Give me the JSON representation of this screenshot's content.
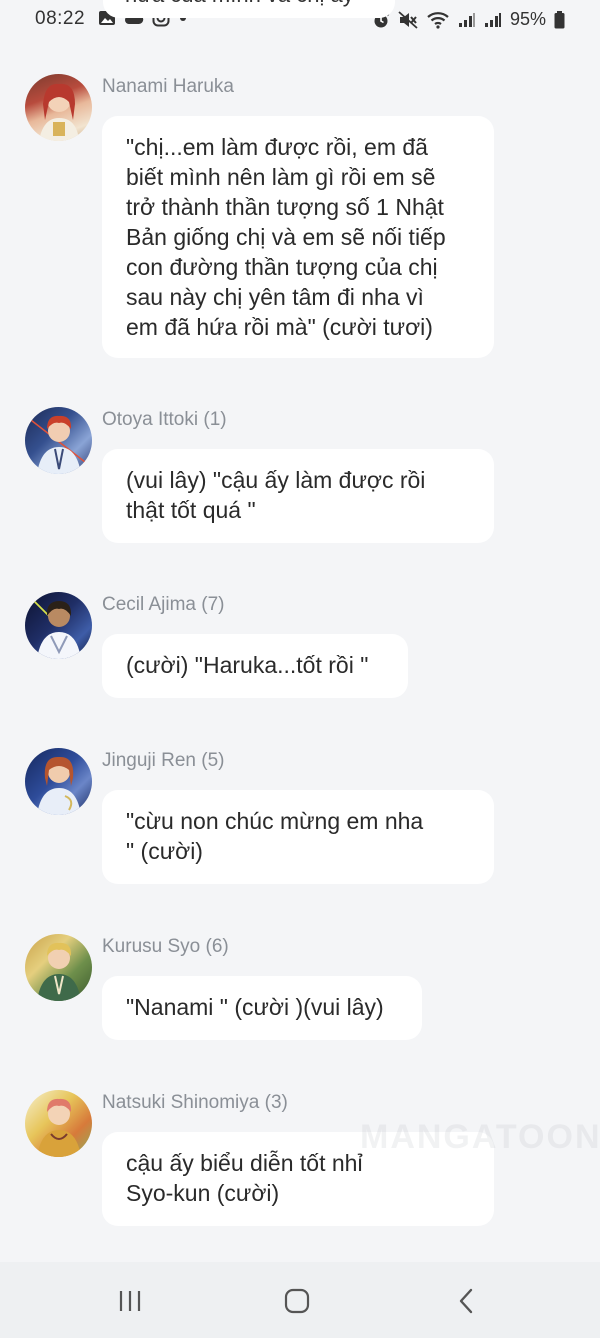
{
  "status_bar": {
    "time": "08:22",
    "battery": "95%",
    "left_icons": [
      "image-icon",
      "cloud-icon",
      "instagram-icon",
      "dot-icon"
    ],
    "right_icons": [
      "alarm-icon",
      "mute-icon",
      "wifi-icon",
      "signal-icon",
      "signal-icon",
      "battery-icon"
    ]
  },
  "top_fragment": {
    "text": "hứa của mình và chị ấy"
  },
  "messages": [
    {
      "name": "Nanami Haruka",
      "avatar": "avatar-nanami-haruka",
      "lines": [
        "\"chị...em làm được rồi, em đã",
        "biết mình nên làm gì rồi em sẽ",
        "trở thành thần tượng số 1 Nhật",
        "Bản giống chị và em sẽ nối tiếp",
        "con đường thần tượng của chị",
        "sau này chị yên tâm đi nha vì",
        "em đã hứa rồi mà\" (cười tươi)"
      ]
    },
    {
      "name": "Otoya Ittoki (1)",
      "avatar": "avatar-otoya-ittoki",
      "lines": [
        "(vui lây) \"cậu ấy làm được rồi",
        "thật tốt quá \""
      ]
    },
    {
      "name": "Cecil Ajima (7)",
      "avatar": "avatar-cecil-ajima",
      "lines": [
        "(cười) \"Haruka...tốt rồi \""
      ]
    },
    {
      "name": "Jinguji Ren (5)",
      "avatar": "avatar-jinguji-ren",
      "lines": [
        "\"cừu non chúc mừng em nha",
        "\" (cười)"
      ]
    },
    {
      "name": "Kurusu Syo (6)",
      "avatar": "avatar-kurusu-syo",
      "lines": [
        "\"Nanami \" (cười )(vui lây)"
      ]
    },
    {
      "name": "Natsuki Shinomiya (3)",
      "avatar": "avatar-natsuki-shinomiya",
      "lines": [
        "cậu ấy biểu diễn tốt nhỉ",
        "Syo-kun (cười)"
      ]
    }
  ],
  "watermark": "MANGATOON",
  "nav_bar": {
    "buttons": [
      "recent-apps-icon",
      "home-icon",
      "back-icon"
    ]
  },
  "colors": {
    "background": "#f4f5f7",
    "bubble": "#ffffff",
    "name_text": "#8a8f96",
    "message_text": "#2a2a2a"
  }
}
